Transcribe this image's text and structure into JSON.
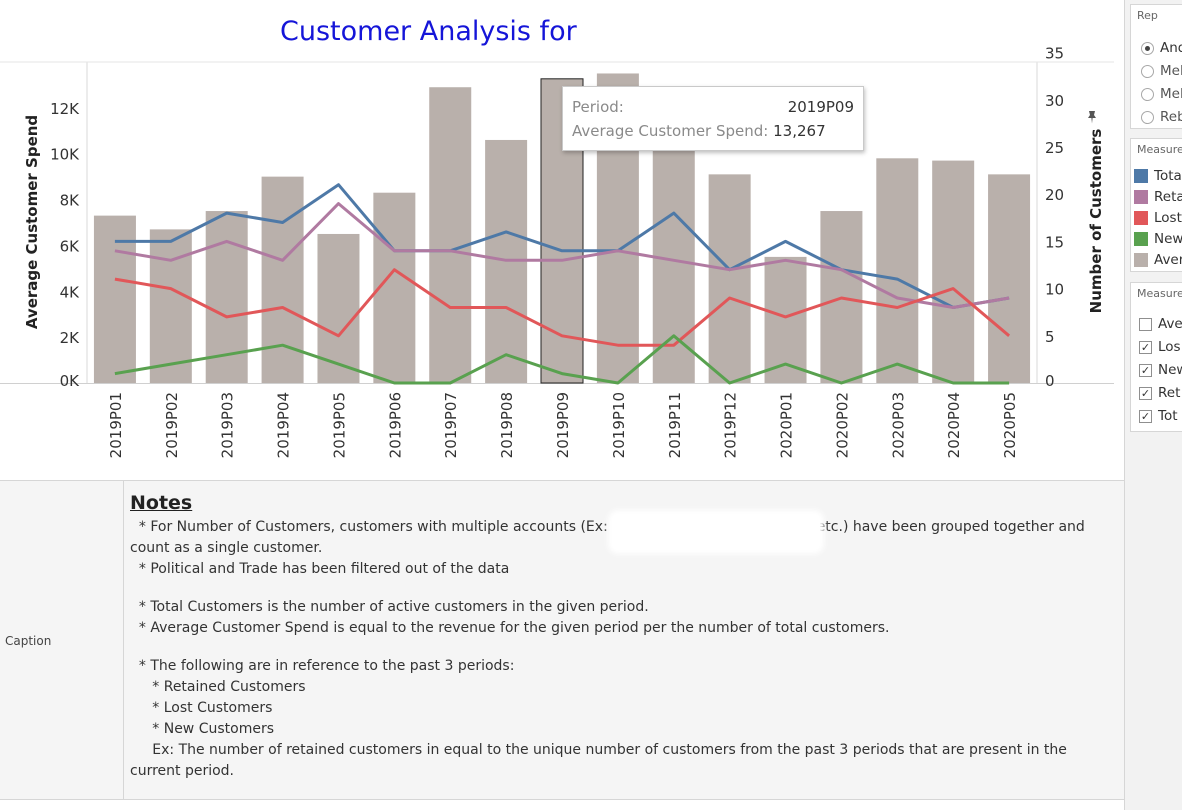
{
  "chart": {
    "title": "Customer Analysis for",
    "y_left_title": "Average Customer Spend",
    "y_right_title": "Number of Customers"
  },
  "chart_data": {
    "type": "bar",
    "categories": [
      "2019P01",
      "2019P02",
      "2019P03",
      "2019P04",
      "2019P05",
      "2019P06",
      "2019P07",
      "2019P08",
      "2019P09",
      "2019P10",
      "2019P11",
      "2019P12",
      "2020P01",
      "2020P02",
      "2020P03",
      "2020P04",
      "2020P05"
    ],
    "bar_series": {
      "name": "Average Customer Spend",
      "axis": "left",
      "values": [
        7300,
        6700,
        7500,
        9000,
        6500,
        8300,
        12900,
        10600,
        13267,
        13500,
        10800,
        9100,
        5500,
        7500,
        9800,
        9700,
        9100
      ],
      "color": "#b9b0ab"
    },
    "line_series": [
      {
        "name": "Total Customers",
        "axis": "right",
        "color": "#4e79a7",
        "values": [
          15,
          15,
          18,
          17,
          21,
          14,
          14,
          16,
          14,
          14,
          18,
          12,
          15,
          12,
          11,
          8,
          9
        ]
      },
      {
        "name": "Retained Customers",
        "axis": "right",
        "color": "#b07aa1",
        "values": [
          14,
          13,
          15,
          13,
          19,
          14,
          14,
          13,
          13,
          14,
          13,
          12,
          13,
          12,
          9,
          8,
          9
        ]
      },
      {
        "name": "Lost Customers",
        "axis": "right",
        "color": "#e15759",
        "values": [
          11,
          10,
          7,
          8,
          5,
          12,
          8,
          8,
          5,
          4,
          4,
          9,
          7,
          9,
          8,
          10,
          5
        ]
      },
      {
        "name": "New Customers",
        "axis": "right",
        "color": "#59a14f",
        "values": [
          1,
          2,
          3,
          4,
          2,
          0,
          0,
          3,
          1,
          0,
          5,
          0,
          2,
          0,
          2,
          0,
          0
        ]
      }
    ],
    "y_left": {
      "ticks": [
        0,
        2000,
        4000,
        6000,
        8000,
        10000,
        12000
      ],
      "tick_labels": [
        "0K",
        "2K",
        "4K",
        "6K",
        "8K",
        "10K",
        "12K"
      ],
      "range": [
        0,
        14000
      ]
    },
    "y_right": {
      "ticks": [
        0,
        5,
        10,
        15,
        20,
        25,
        30,
        35
      ],
      "range": [
        0,
        34
      ]
    },
    "highlighted_category": "2019P09",
    "xlabel": "",
    "grid": false
  },
  "tooltip": {
    "period_label": "Period:",
    "period_value": "2019P09",
    "spend_label": "Average Customer Spend:",
    "spend_value": "13,267"
  },
  "sidebar": {
    "rep_title": "Rep",
    "rep_options": [
      {
        "label": "And",
        "selected": true
      },
      {
        "label": "Mel",
        "selected": false
      },
      {
        "label": "Mel",
        "selected": false
      },
      {
        "label": "Reb",
        "selected": false
      }
    ],
    "legend_title": "Measure",
    "legend_items": [
      {
        "label": "Tota",
        "color": "#4e79a7"
      },
      {
        "label": "Reta",
        "color": "#b07aa1"
      },
      {
        "label": "Lost",
        "color": "#e15759"
      },
      {
        "label": "New",
        "color": "#59a14f"
      },
      {
        "label": "Aver",
        "color": "#b9b0ab"
      }
    ],
    "filter_title": "Measure",
    "filter_items": [
      {
        "label": "Ave",
        "checked": false
      },
      {
        "label": "Los",
        "checked": true
      },
      {
        "label": "New",
        "checked": true
      },
      {
        "label": "Ret",
        "checked": true
      },
      {
        "label": "Tot",
        "checked": true
      }
    ]
  },
  "caption": {
    "label": "Caption",
    "notes_title": "Notes",
    "lines": [
      "  * For Number of Customers, customers with multiple accounts (Ex:",
      ", etc.) have been grouped together and count as a single customer.",
      "  * Political and Trade has been filtered out of the data",
      "",
      "  * Total Customers is the number of active customers in the given period.",
      "  * Average Customer Spend is equal to the revenue for the given period per the number of total customers.",
      "",
      "  * The following are in reference to the past 3 periods:",
      "     * Retained Customers",
      "     * Lost Customers",
      "     * New Customers",
      "     Ex: The number of retained customers in equal to the unique number of customers from the past 3 periods that are present in the current period."
    ]
  }
}
